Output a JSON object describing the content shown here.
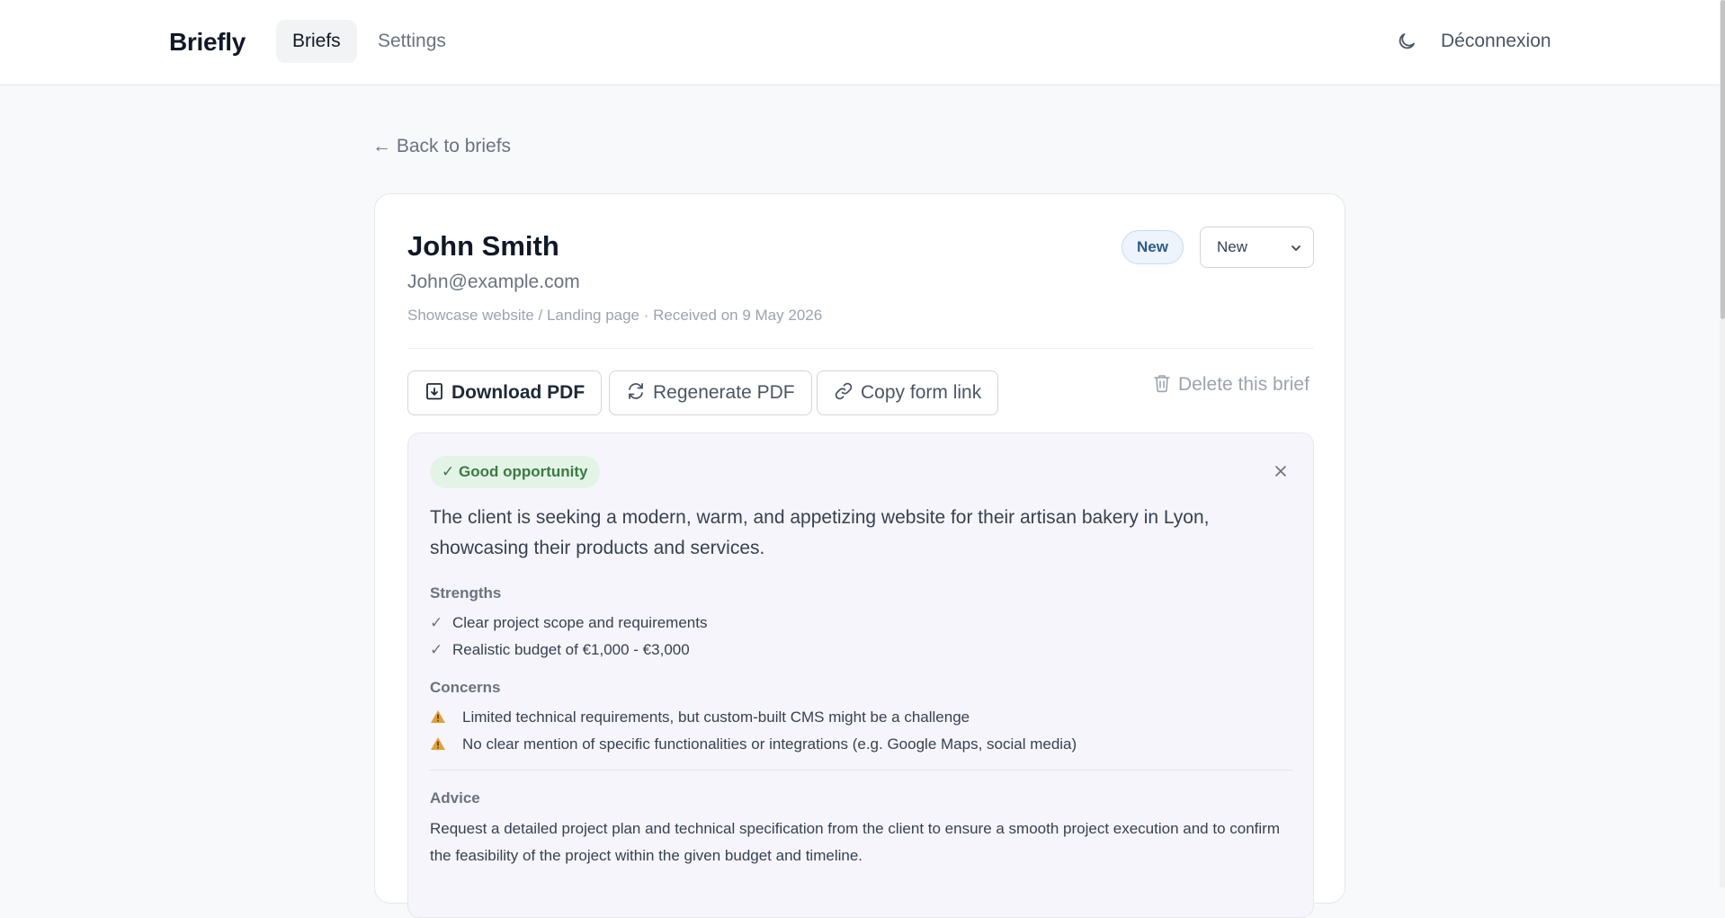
{
  "header": {
    "brand": "Briefly",
    "nav": [
      {
        "label": "Briefs",
        "active": true
      },
      {
        "label": "Settings",
        "active": false
      }
    ],
    "theme_icon": "moon-icon",
    "logout_label": "Déconnexion"
  },
  "back_link": "← Back to briefs",
  "brief": {
    "client_name": "John Smith",
    "client_email": "John@example.com",
    "meta": "Showcase website / Landing page · Received on 9 May 2026",
    "status_badge": "New",
    "status_select": {
      "value": "New"
    },
    "actions": {
      "download": {
        "label": "Download PDF",
        "icon": "download-icon"
      },
      "regenerate": {
        "label": "Regenerate PDF",
        "icon": "refresh-icon"
      },
      "copy": {
        "label": "Copy form link",
        "icon": "link-icon"
      },
      "delete": {
        "label": "Delete this brief",
        "icon": "trash-icon"
      }
    }
  },
  "analysis": {
    "verdict": "✓ Good opportunity",
    "verdict_color": "#3b7a45",
    "summary": "The client is seeking a modern, warm, and appetizing website for their artisan bakery in Lyon, showcasing their products and services.",
    "strengths_label": "Strengths",
    "strengths": [
      "Clear project scope and requirements",
      "Realistic budget of €1,000 - €3,000"
    ],
    "concerns_label": "Concerns",
    "concerns": [
      "Limited technical requirements, but custom-built CMS might be a challenge",
      "No clear mention of specific functionalities or integrations (e.g. Google Maps, social media)"
    ],
    "advice_label": "Advice",
    "advice": "Request a detailed project plan and technical specification from the client to ensure a smooth project execution and to confirm the feasibility of the project within the given budget and timeline."
  }
}
